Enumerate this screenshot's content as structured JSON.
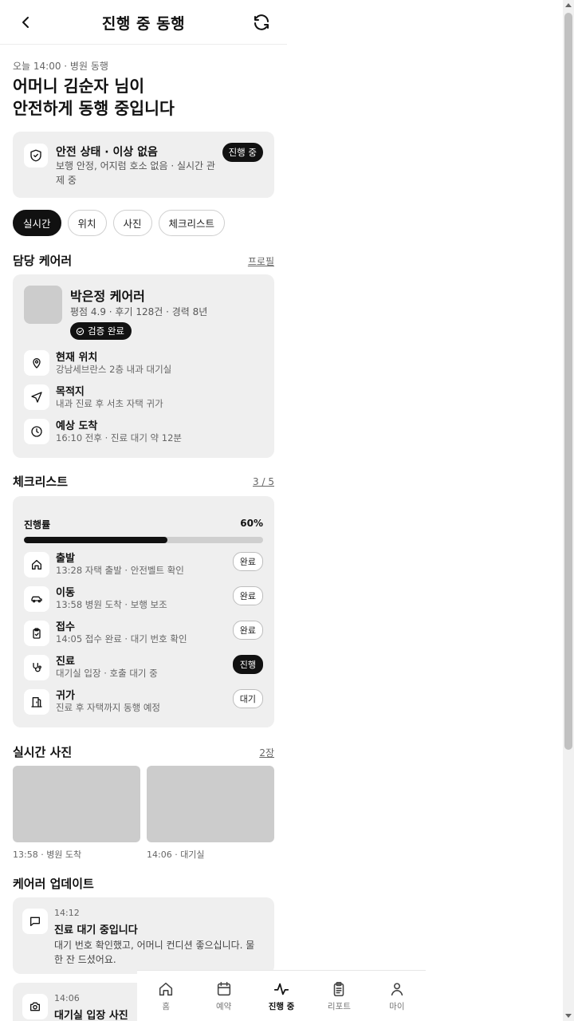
{
  "header": {
    "title": "진행 중 동행",
    "back_icon": "back-chevron-icon",
    "refresh_icon": "refresh-icon"
  },
  "hero": {
    "subtitle": "오늘 14:00 · 병원 동행",
    "line1": "어머니 김순자 님이",
    "line2": "안전하게 동행 중입니다"
  },
  "safety": {
    "title": "안전 상태 · 이상 없음",
    "desc": "보행 안정, 어지럼 호소 없음 · 실시간 관제 중",
    "badge": "진행 중"
  },
  "tabs": [
    {
      "label": "실시간",
      "active": true
    },
    {
      "label": "위치",
      "active": false
    },
    {
      "label": "사진",
      "active": false
    },
    {
      "label": "체크리스트",
      "active": false
    }
  ],
  "carer_section": {
    "title": "담당 케어러",
    "link": "프로필"
  },
  "carer": {
    "name": "박은정 케어러",
    "meta": "평점 4.9 · 후기 128건 · 경력 8년",
    "verified": "검증 완료",
    "rows": [
      {
        "title": "현재 위치",
        "sub": "강남세브란스 2층 내과 대기실",
        "icon": "location-pin-icon"
      },
      {
        "title": "목적지",
        "sub": "내과 진료 후 서초 자택 귀가",
        "icon": "navigation-icon"
      },
      {
        "title": "예상 도착",
        "sub": "16:10 전후 · 진료 대기 약 12분",
        "icon": "clock-icon"
      }
    ]
  },
  "checklist_section": {
    "title": "체크리스트",
    "link": "3 / 5"
  },
  "checklist": {
    "progress_label": "진행률",
    "progress_text": "60%",
    "progress": 0.6,
    "steps": [
      {
        "title": "출발",
        "sub": "13:28 자택 출발 · 안전벨트 확인",
        "badge": "완료",
        "icon": "home-icon",
        "dark": false
      },
      {
        "title": "이동",
        "sub": "13:58 병원 도착 · 보행 보조",
        "badge": "완료",
        "icon": "car-icon",
        "dark": false
      },
      {
        "title": "접수",
        "sub": "14:05 접수 완료 · 대기 번호 확인",
        "badge": "완료",
        "icon": "clipboard-icon",
        "dark": false
      },
      {
        "title": "진료",
        "sub": "대기실 입장 · 호출 대기 중",
        "badge": "진행",
        "icon": "stethoscope-icon",
        "dark": true
      },
      {
        "title": "귀가",
        "sub": "진료 후 자택까지 동행 예정",
        "badge": "대기",
        "icon": "door-icon",
        "dark": false
      }
    ]
  },
  "photos_section": {
    "title": "실시간 사진",
    "link": "2장"
  },
  "photos": [
    {
      "caption": "13:58 · 병원 도착"
    },
    {
      "caption": "14:06 · 대기실"
    }
  ],
  "updates_section": {
    "title": "케어러 업데이트"
  },
  "updates": [
    {
      "time": "14:12",
      "title": "진료 대기 중입니다",
      "body": "대기 번호 확인했고, 어머니 컨디션 좋으십니다. 물 한 잔 드셨어요.",
      "icon": "message-icon"
    },
    {
      "time": "14:06",
      "title": "대기실 입장 사진",
      "body": "",
      "icon": "camera-icon"
    }
  ],
  "nav": [
    {
      "label": "홈",
      "icon": "home-icon",
      "active": false
    },
    {
      "label": "예약",
      "icon": "calendar-icon",
      "active": false
    },
    {
      "label": "진행 중",
      "icon": "activity-icon",
      "active": true
    },
    {
      "label": "리포트",
      "icon": "report-icon",
      "active": false
    },
    {
      "label": "마이",
      "icon": "user-icon",
      "active": false
    }
  ]
}
